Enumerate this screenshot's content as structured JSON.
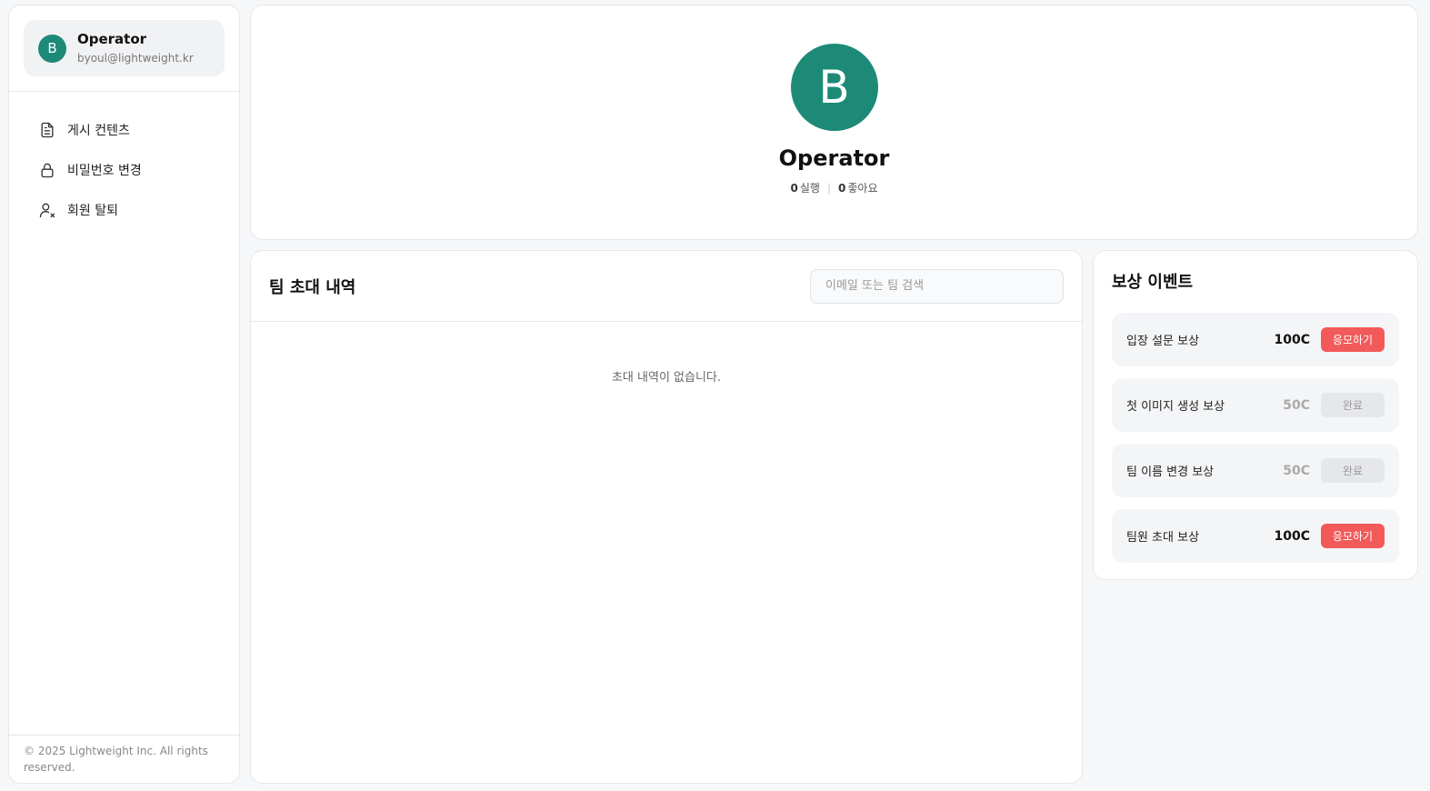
{
  "user": {
    "initial": "B",
    "name": "Operator",
    "email": "byoul@lightweight.kr"
  },
  "nav": {
    "items": [
      {
        "label": "게시 컨텐츠",
        "icon": "document-icon"
      },
      {
        "label": "비밀번호 변경",
        "icon": "lock-icon"
      },
      {
        "label": "회원 탈퇴",
        "icon": "user-remove-icon"
      }
    ]
  },
  "footer": {
    "copyright": "© 2025 Lightweight Inc. All rights reserved."
  },
  "profile": {
    "stats": {
      "runs_count": "0",
      "runs_label": "실행",
      "likes_count": "0",
      "likes_label": "좋아요"
    }
  },
  "invites": {
    "title": "팀 초대 내역",
    "search_placeholder": "이메일 또는 팀 검색",
    "search_value": "",
    "empty_text": "초대 내역이 없습니다."
  },
  "rewards": {
    "title": "보상 이벤트",
    "items": [
      {
        "name": "입장 설문 보상",
        "amount": "100C",
        "button": "응모하기",
        "status": "active"
      },
      {
        "name": "첫 이미지 생성 보상",
        "amount": "50C",
        "button": "완료",
        "status": "done"
      },
      {
        "name": "팀 이름 변경 보상",
        "amount": "50C",
        "button": "완료",
        "status": "done"
      },
      {
        "name": "팀원 초대 보상",
        "amount": "100C",
        "button": "응모하기",
        "status": "active"
      }
    ]
  },
  "colors": {
    "avatar": "#1d8a78",
    "accent_button": "#f25a5a",
    "done_button": "#e6e7ea"
  }
}
